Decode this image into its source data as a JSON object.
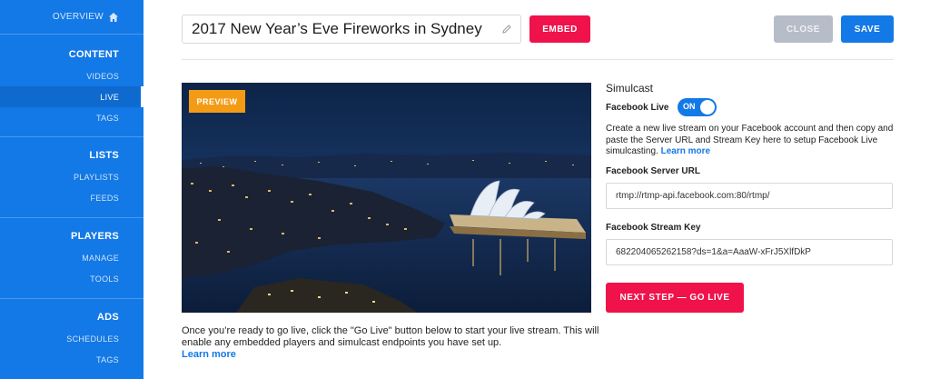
{
  "sidebar": {
    "overview": "OVERVIEW",
    "sections": [
      {
        "title": "CONTENT",
        "items": [
          "VIDEOS",
          "LIVE",
          "TAGS"
        ]
      },
      {
        "title": "LISTS",
        "items": [
          "PLAYLISTS",
          "FEEDS"
        ]
      },
      {
        "title": "PLAYERS",
        "items": [
          "MANAGE",
          "TOOLS"
        ]
      },
      {
        "title": "ADS",
        "items": [
          "SCHEDULES",
          "TAGS"
        ]
      }
    ],
    "active_item": "LIVE"
  },
  "header": {
    "title": "2017 New Year’s Eve Fireworks in Sydney",
    "embed_label": "EMBED",
    "close_label": "CLOSE",
    "save_label": "SAVE"
  },
  "preview": {
    "badge": "PREVIEW",
    "instructions": "Once you’re ready to go live, click the \"Go Live\" button below to start your live stream. This will enable any embedded players and simulcast endpoints you have set up.",
    "learn_more": "Learn more"
  },
  "simulcast": {
    "title": "Simulcast",
    "facebook_live_label": "Facebook Live",
    "toggle_label": "ON",
    "description": "Create a new live stream on your Facebook account and then copy and paste the Server URL and Stream Key here to setup Facebook Live simulcasting.",
    "learn_more": "Learn more",
    "server_url_label": "Facebook Server URL",
    "server_url_value": "rtmp://rtmp-api.facebook.com:80/rtmp/",
    "stream_key_label": "Facebook Stream Key",
    "stream_key_value": "682204065262158?ds=1&a=AaaW-xFrJ5XlfDkP",
    "next_step_label": "NEXT STEP — GO LIVE"
  },
  "colors": {
    "brand_blue": "#1379e6",
    "accent_red": "#f0124a",
    "preview_orange": "#f49b16",
    "close_gray": "#b6bcc8"
  }
}
